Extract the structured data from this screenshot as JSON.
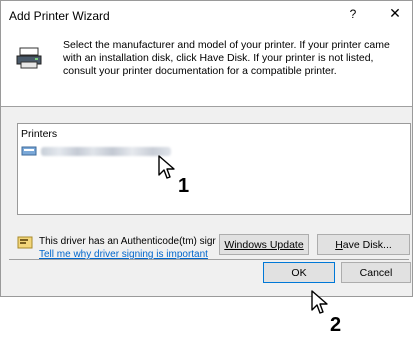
{
  "window": {
    "title": "Add Printer Wizard",
    "help": "?",
    "close": "✕"
  },
  "header": {
    "text": "Select the manufacturer and model of your printer. If your printer came with an installation disk, click Have Disk. If your printer is not listed, consult your printer documentation for a compatible printer."
  },
  "printers": {
    "column_header": "Printers",
    "selected_item": ""
  },
  "signing": {
    "text": "This driver has an Authenticode(tm) sigr",
    "link": "Tell me why driver signing is important"
  },
  "buttons": {
    "windows_update": "Windows Update",
    "have_disk_prefix": "H",
    "have_disk_rest": "ave Disk...",
    "ok": "OK",
    "cancel": "Cancel"
  },
  "annotations": {
    "step1": "1",
    "step2": "2"
  }
}
